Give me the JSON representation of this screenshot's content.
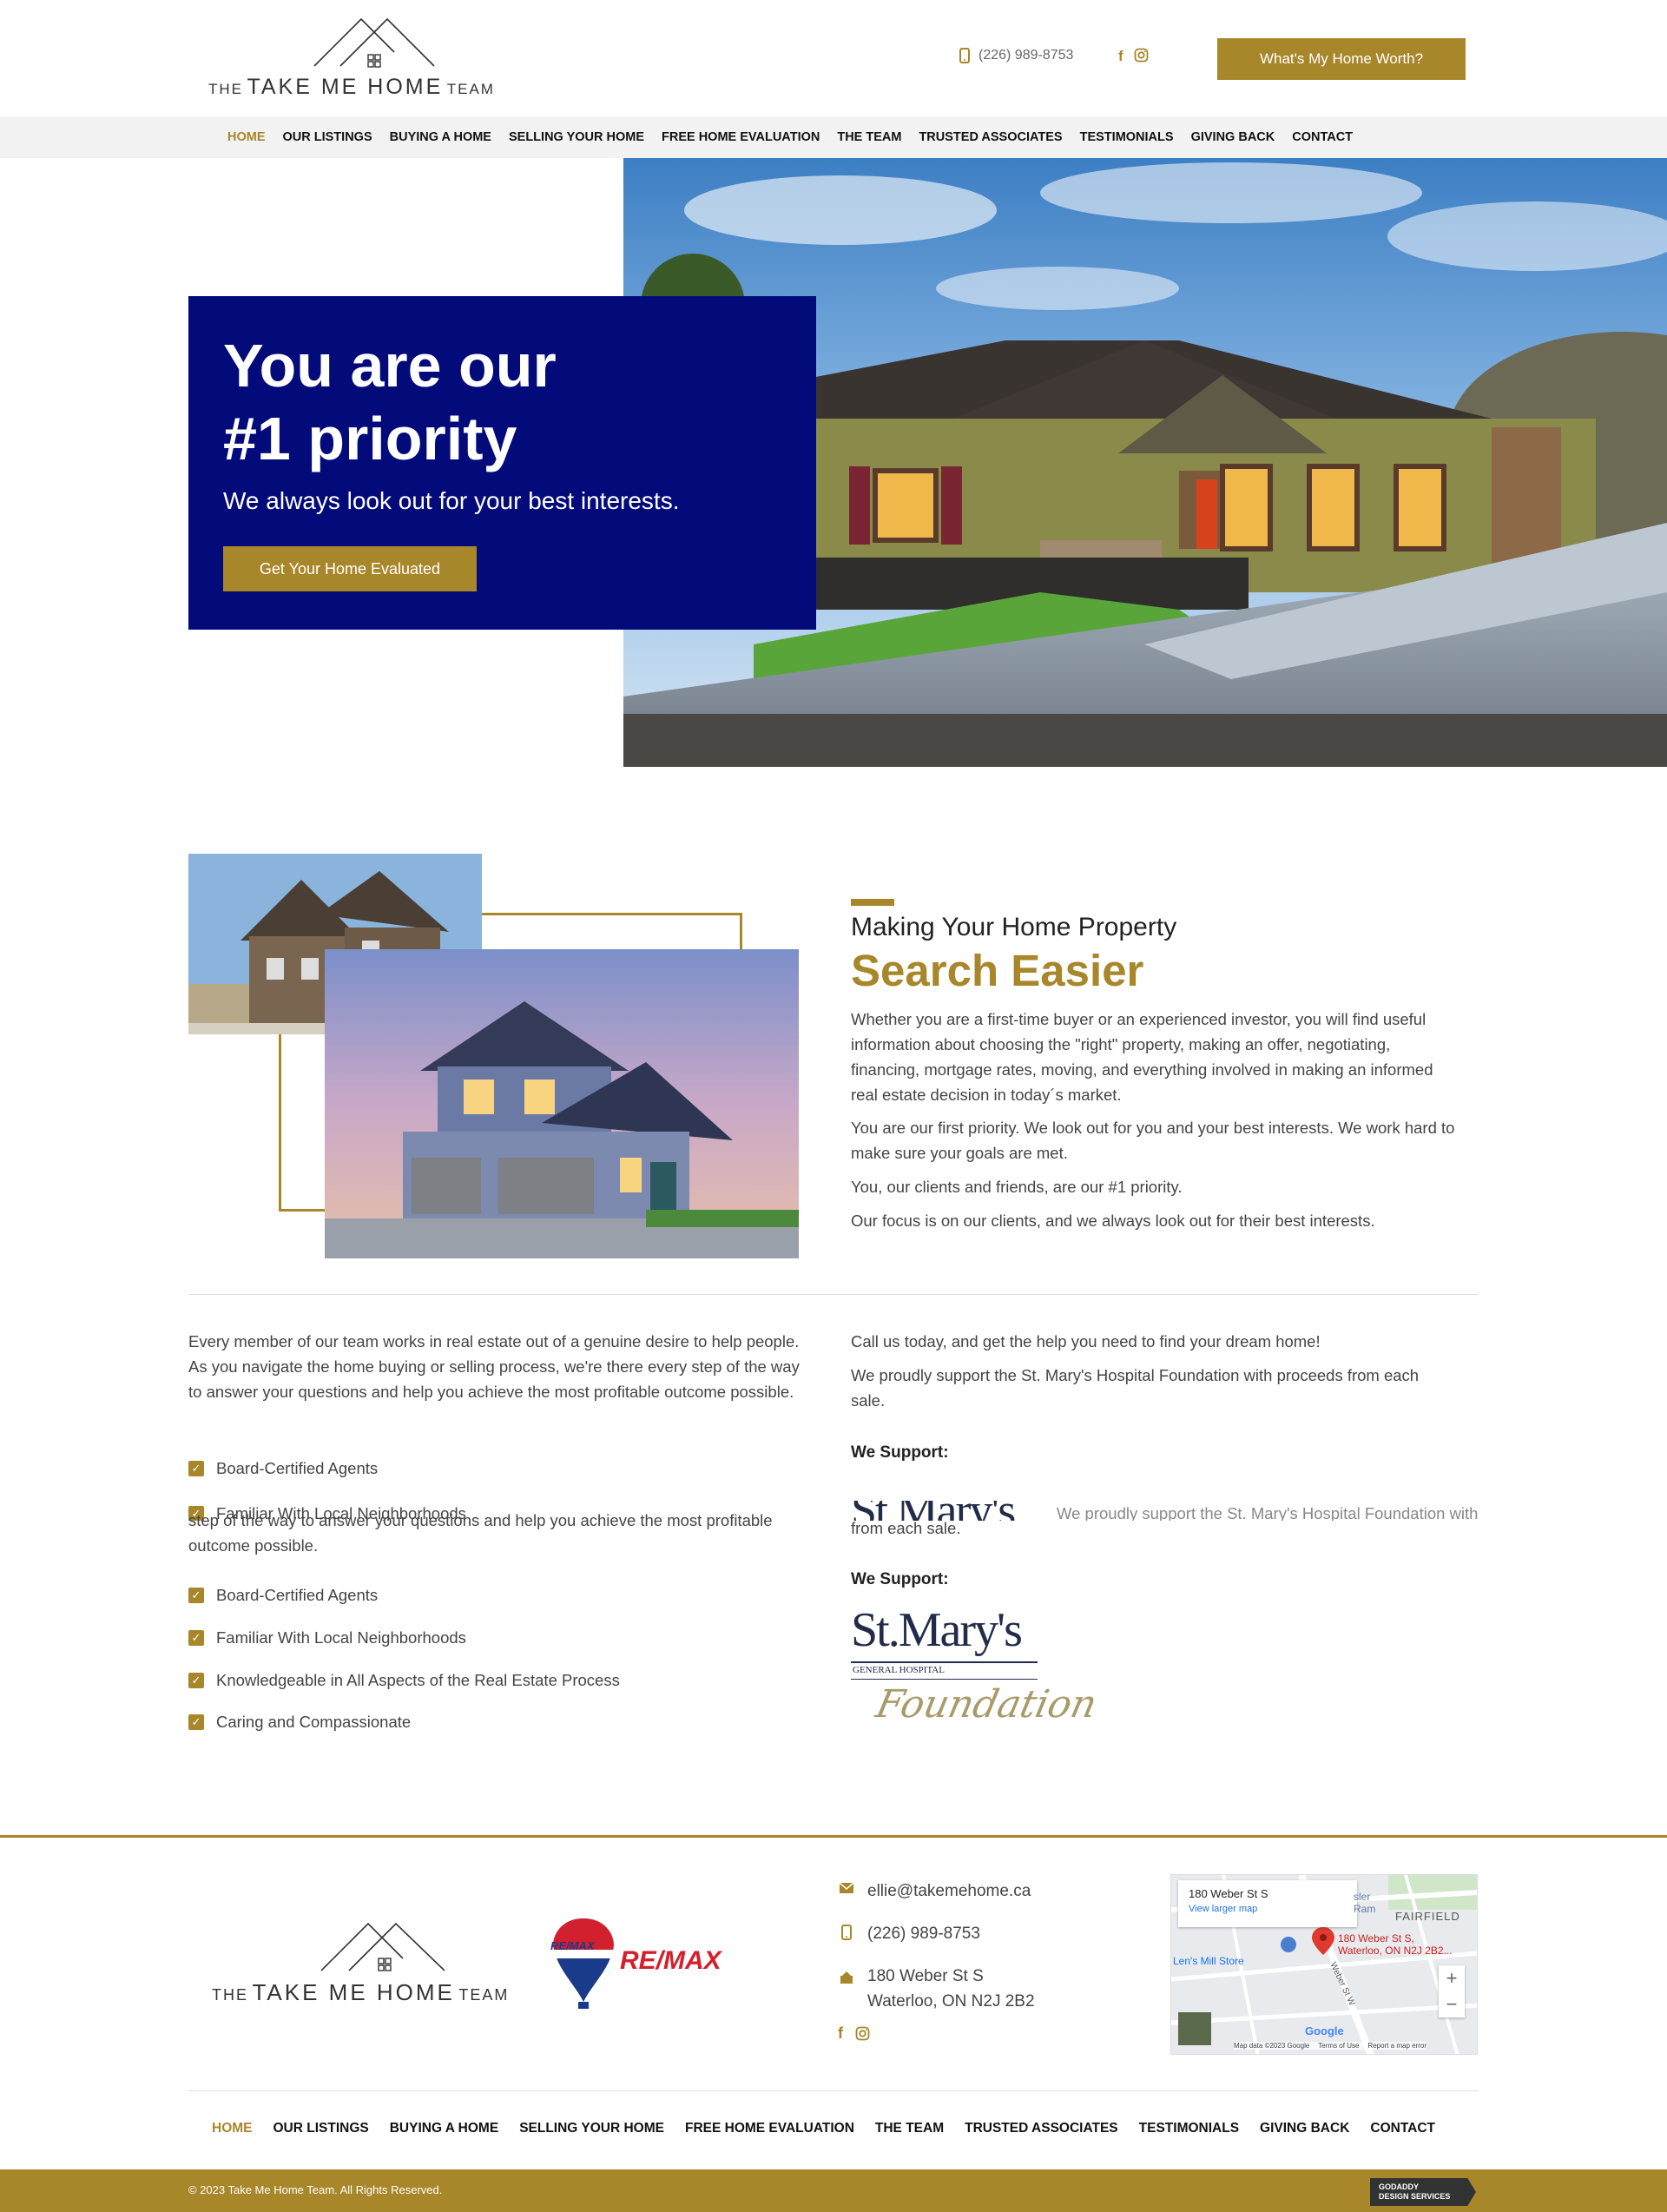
{
  "brand": {
    "logo_small_left": "THE",
    "logo_main": "TAKE ME HOME",
    "logo_small_right": "TEAM"
  },
  "header": {
    "phone": "(226) 989-8753",
    "cta_button": "What's My Home Worth?"
  },
  "nav": {
    "items": [
      "HOME",
      "OUR LISTINGS",
      "BUYING A HOME",
      "SELLING YOUR HOME",
      "FREE HOME EVALUATION",
      "THE TEAM",
      "TRUSTED ASSOCIATES",
      "TESTIMONIALS",
      "GIVING BACK",
      "CONTACT"
    ],
    "active": "HOME"
  },
  "hero": {
    "title_line1": "You are our",
    "title_line2": "#1 priority",
    "subtitle": "We always look out for your best interests.",
    "button": "Get Your Home Evaluated"
  },
  "about": {
    "subheading": "Making Your Home Property",
    "heading": "Search Easier",
    "paragraphs": [
      "Whether you are a first-time buyer or an experienced investor, you will find useful information about choosing the \"right\" property, making an offer, negotiating, financing, mortgage rates, moving, and everything involved in making an informed real estate decision in today´s market.",
      "You are our first priority. We look out for you and your best interests. We work hard to make sure your goals are met.",
      "You, our clients and friends, are our #1 priority.",
      "Our focus is on our clients, and we always look out for their best interests."
    ]
  },
  "team": {
    "intro": "Every member of our team works in real estate out of a genuine desire to help people. As you navigate the home buying or selling process, we're there every step of the way to answer your questions and help you achieve the most profitable outcome possible.",
    "intro_tail": "step of the way to answer your questions and help you achieve the most profitable outcome possible.",
    "checklist": [
      "Board-Certified Agents",
      "Familiar With Local Neighborhoods",
      "Knowledgeable in All Aspects of the Real Estate Process",
      "Caring and Compassionate"
    ],
    "call_text": "Call us today, and get the help you need to find your dream home!",
    "support_text": "We proudly support the St. Mary's Hospital Foundation with proceeds from each sale.",
    "support_tail": "from each sale.",
    "we_support": "We Support:",
    "foundation_name": "St.Mary's",
    "foundation_sub": "GENERAL HOSPITAL",
    "foundation_script": "Foundation"
  },
  "footer": {
    "remax": "RE/MAX",
    "email": "ellie@takemehome.ca",
    "phone": "(226) 989-8753",
    "address_line1": "180 Weber St S",
    "address_line2": "Waterloo, ON N2J 2B2",
    "map": {
      "place": "180 Weber St S",
      "link": "View larger map",
      "pin_label_1": "180 Weber St S,",
      "pin_label_2": "Waterloo, ON N2J 2B2...",
      "area": "FAIRFIELD",
      "store": "Len's Mill Store",
      "sl_1": "sler",
      "sl_2": "Ram",
      "credits": "Map data ©2023 Google",
      "terms": "Terms of Use",
      "report": "Report a map error",
      "google": "Google",
      "street": "Weber St W"
    },
    "copyright": "© 2023 Take Me Home Team. All Rights Reserved.",
    "godaddy_line1": "GODADDY",
    "godaddy_line2": "DESIGN SERVICES"
  },
  "colors": {
    "gold": "#a8862a",
    "navy": "#030a7a"
  }
}
